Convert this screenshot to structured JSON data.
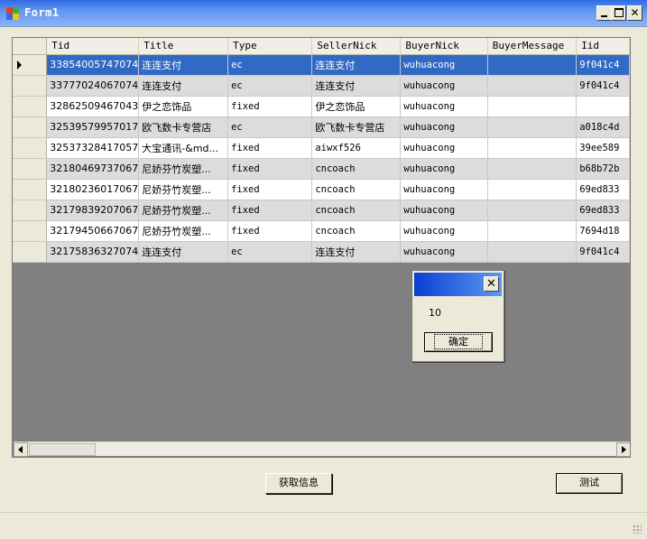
{
  "window": {
    "title": "Form1",
    "icon": "form-app-icon"
  },
  "grid": {
    "columns": [
      "Tid",
      "Title",
      "Type",
      "SellerNick",
      "BuyerNick",
      "BuyerMessage",
      "Iid"
    ],
    "rows": [
      [
        "33854005747074",
        "连连支付",
        "ec",
        "连连支付",
        "wuhuacong",
        "",
        "9f041c4"
      ],
      [
        "33777024067074",
        "连连支付",
        "ec",
        "连连支付",
        "wuhuacong",
        "",
        "9f041c4"
      ],
      [
        "32862509467043",
        "伊之恋饰品",
        "fixed",
        "伊之恋饰品",
        "wuhuacong",
        "",
        ""
      ],
      [
        "32539579957017",
        "欧飞数卡专营店",
        "ec",
        "欧飞数卡专营店",
        "wuhuacong",
        "",
        "a018c4d"
      ],
      [
        "32537328417057",
        "大宝通讯-&md...",
        "fixed",
        "aiwxf526",
        "wuhuacong",
        "",
        "39ee589"
      ],
      [
        "32180469737067",
        "尼娇芬竹炭塑...",
        "fixed",
        "cncoach",
        "wuhuacong",
        "",
        "b68b72b"
      ],
      [
        "32180236017067",
        "尼娇芬竹炭塑...",
        "fixed",
        "cncoach",
        "wuhuacong",
        "",
        "69ed833"
      ],
      [
        "32179839207067",
        "尼娇芬竹炭塑...",
        "fixed",
        "cncoach",
        "wuhuacong",
        "",
        "69ed833"
      ],
      [
        "32179450667067",
        "尼娇芬竹炭塑...",
        "fixed",
        "cncoach",
        "wuhuacong",
        "",
        "7694d18"
      ],
      [
        "32175836327074",
        "连连支付",
        "ec",
        "连连支付",
        "wuhuacong",
        "",
        "9f041c4"
      ]
    ],
    "selected_row": 0
  },
  "messagebox": {
    "text": "10",
    "ok_label": "确定"
  },
  "buttons": {
    "get_info": "获取信息",
    "test": "测试"
  },
  "colors": {
    "selection": "#316ac5",
    "title_gradient_start": "#2f6be3",
    "grid_background": "#808080"
  }
}
